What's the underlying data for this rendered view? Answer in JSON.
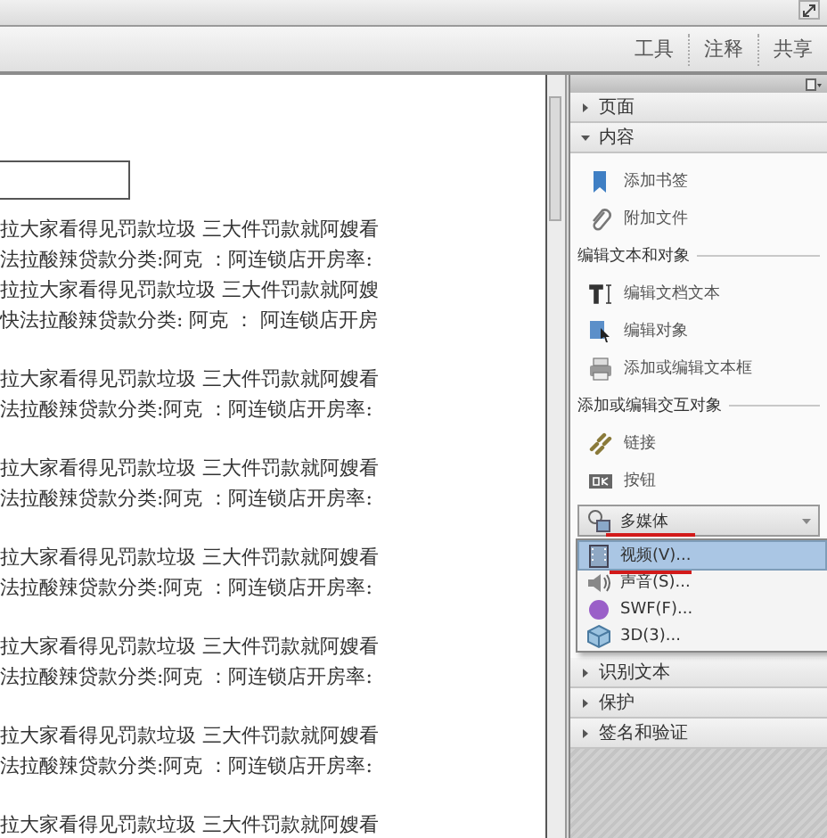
{
  "toolbar": {
    "tabs": [
      {
        "label": "工具",
        "selected": false
      },
      {
        "label": "注释",
        "selected": false
      },
      {
        "label": "共享",
        "selected": false
      }
    ]
  },
  "document": {
    "paragraphs": [
      {
        "lines": [
          "拉大家看得见罚款垃圾 三大件罚款就阿嫂看",
          "法拉酸辣贷款分类:阿克 ：阿连锁店开房率:",
          "拉拉大家看得见罚款垃圾 三大件罚款就阿嫂",
          "快法拉酸辣贷款分类: 阿克 ： 阿连锁店开房"
        ]
      },
      {
        "lines": [
          "拉大家看得见罚款垃圾 三大件罚款就阿嫂看",
          "法拉酸辣贷款分类:阿克 ：阿连锁店开房率:"
        ]
      },
      {
        "lines": [
          "拉大家看得见罚款垃圾 三大件罚款就阿嫂看",
          "法拉酸辣贷款分类:阿克 ：阿连锁店开房率:"
        ]
      },
      {
        "lines": [
          "拉大家看得见罚款垃圾 三大件罚款就阿嫂看",
          "法拉酸辣贷款分类:阿克 ：阿连锁店开房率:"
        ]
      },
      {
        "lines": [
          "拉大家看得见罚款垃圾 三大件罚款就阿嫂看",
          "法拉酸辣贷款分类:阿克 ：阿连锁店开房率:"
        ]
      },
      {
        "lines": [
          "拉大家看得见罚款垃圾 三大件罚款就阿嫂看",
          "法拉酸辣贷款分类:阿克 ：阿连锁店开房率:"
        ]
      },
      {
        "lines": [
          "拉大家看得见罚款垃圾 三大件罚款就阿嫂看"
        ]
      }
    ]
  },
  "panel": {
    "top_groups": [
      {
        "label": "页面",
        "expanded": false
      },
      {
        "label": "内容",
        "expanded": true
      }
    ],
    "content": [
      {
        "kind": "tool",
        "label": "添加书签"
      },
      {
        "kind": "tool",
        "label": "附加文件"
      },
      {
        "kind": "section",
        "label": "编辑文本和对象"
      },
      {
        "kind": "tool",
        "label": "编辑文档文本"
      },
      {
        "kind": "tool",
        "label": "编辑对象"
      },
      {
        "kind": "tool",
        "label": "添加或编辑文本框"
      },
      {
        "kind": "section",
        "label": "添加或编辑交互对象"
      },
      {
        "kind": "tool",
        "label": "链接"
      },
      {
        "kind": "tool",
        "label": "按钮"
      },
      {
        "kind": "dropdown",
        "label": "多媒体"
      }
    ],
    "menu": [
      {
        "label": "视频(V)...",
        "selected": true
      },
      {
        "label": "声音(S)...",
        "selected": false
      },
      {
        "label": "SWF(F)...",
        "selected": false
      },
      {
        "label": "3D(3)...",
        "selected": false
      }
    ],
    "bottom_groups": [
      {
        "label": "识别文本",
        "expanded": false
      },
      {
        "label": "保护",
        "expanded": false
      },
      {
        "label": "签名和验证",
        "expanded": false
      }
    ]
  }
}
